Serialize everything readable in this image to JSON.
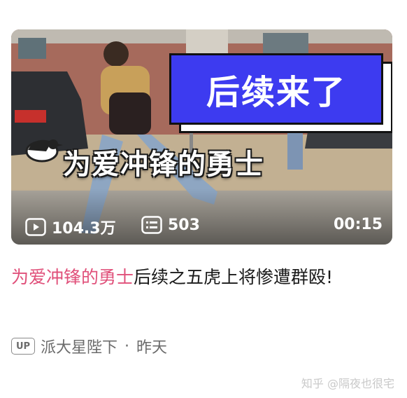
{
  "video": {
    "badge_text": "后续来了",
    "subtitle_text": "为爱冲锋的勇士",
    "views": "104.3万",
    "danmaku": "503",
    "duration": "00:15",
    "icons": {
      "views": "play-icon",
      "danmaku": "danmaku-icon",
      "bird": "magpie-icon"
    }
  },
  "title": {
    "highlight": "为爱冲锋的勇士",
    "rest": "后续之五虎上将惨遭群殴!"
  },
  "meta": {
    "up_label": "UP",
    "author": "派大星陛下",
    "separator": "·",
    "time": "昨天"
  },
  "watermark": "知乎 @隔夜也很宅",
  "colors": {
    "highlight": "#e0507a",
    "badge_blue": "#3d3bf0"
  }
}
